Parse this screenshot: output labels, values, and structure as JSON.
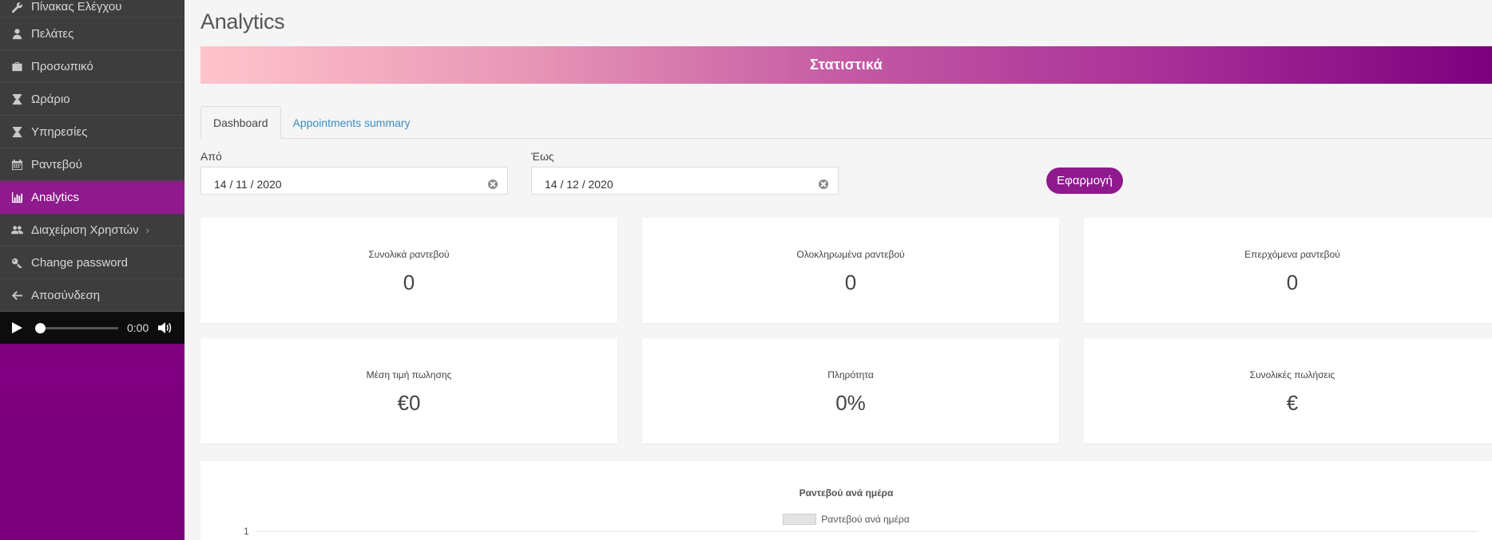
{
  "sidebar": {
    "items": [
      {
        "label": "Πίνακας Ελέγχου",
        "icon": "wrench-icon"
      },
      {
        "label": "Πελάτες",
        "icon": "user-icon"
      },
      {
        "label": "Προσωπικό",
        "icon": "briefcase-icon"
      },
      {
        "label": "Ωράριο",
        "icon": "hourglass-icon"
      },
      {
        "label": "Υπηρεσίες",
        "icon": "hourglass-icon"
      },
      {
        "label": "Ραντεβού",
        "icon": "calendar-icon"
      },
      {
        "label": "Analytics",
        "icon": "bar-chart-icon"
      },
      {
        "label": "Διαχείριση Χρηστών",
        "icon": "users-icon"
      },
      {
        "label": "Change password",
        "icon": "key-icon"
      },
      {
        "label": "Αποσύνδεση",
        "icon": "arrow-left-icon"
      }
    ],
    "active_item": "Analytics",
    "player": {
      "time": "0:00",
      "progress": 0
    }
  },
  "main": {
    "title": "Analytics",
    "banner": "Στατιστικά",
    "tabs": [
      {
        "label": "Dashboard",
        "active": true
      },
      {
        "label": "Appointments summary",
        "active": false
      }
    ],
    "filters": {
      "from_label": "Από",
      "from_value": "14 / 11 / 2020",
      "to_label": "Έως",
      "to_value": "14 / 12 / 2020",
      "apply_label": "Εφαρμογή"
    },
    "cards": [
      {
        "label": "Συνολικά ραντεβού",
        "value": "0"
      },
      {
        "label": "Ολοκληρωμένα ραντεβού",
        "value": "0"
      },
      {
        "label": "Επερχόμενα ραντεβού",
        "value": "0"
      },
      {
        "label": "Μέση τιμή πωλησης",
        "value": "€0"
      },
      {
        "label": "Πληρότητα",
        "value": "0%"
      },
      {
        "label": "Συνολικές πωλήσεις",
        "value": "€"
      }
    ],
    "chart": {
      "title": "Ραντεβού ανά ημέρα",
      "legend": "Ραντεβού ανά ημέρα",
      "tick": "1"
    }
  },
  "colors": {
    "accent": "#8e1a8d",
    "sidebar_menu_bg": "#3d3d3d",
    "link": "#3e8cc0"
  },
  "chart_data": {
    "type": "bar",
    "title": "Ραντεβού ανά ημέρα",
    "series": [
      {
        "name": "Ραντεβού ανά ημέρα",
        "values": []
      }
    ],
    "y_tick_labels": [
      "1"
    ]
  }
}
